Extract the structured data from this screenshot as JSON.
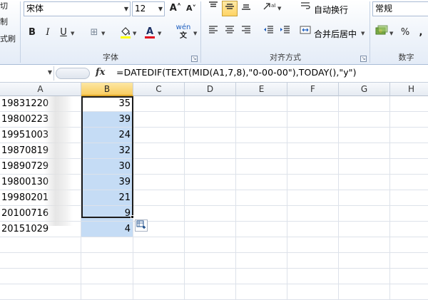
{
  "ribbon": {
    "clipboard": {
      "cut_label": "切",
      "copy_label": "制",
      "painter_label": "式刷"
    },
    "font": {
      "name": "宋体",
      "size": "12",
      "grow_icon": "A˄",
      "shrink_icon": "A˅",
      "bold": "B",
      "italic": "I",
      "underline": "U",
      "phonetic": "wén",
      "group_label": "字体"
    },
    "alignment": {
      "wrap_text": "自动换行",
      "merge_center": "合并后居中",
      "group_label": "对齐方式"
    },
    "number": {
      "format": "常规",
      "percent": "%",
      "comma": ",",
      "group_label": "数字"
    }
  },
  "formula_bar": {
    "fx_label": "fx",
    "formula": "=DATEDIF(TEXT(MID(A1,7,8),\"0-00-00\"),TODAY(),\"y\")"
  },
  "columns": [
    "A",
    "B",
    "C",
    "D",
    "E",
    "F",
    "G",
    "H"
  ],
  "rows": [
    {
      "a": "19831220",
      "b": "35"
    },
    {
      "a": "19800223",
      "b": "39"
    },
    {
      "a": "19951003",
      "b": "24"
    },
    {
      "a": "19870819",
      "b": "32"
    },
    {
      "a": "19890729",
      "b": "30"
    },
    {
      "a": "19800130",
      "b": "39"
    },
    {
      "a": "19980201",
      "b": "21"
    },
    {
      "a": "20100716",
      "b": "9"
    },
    {
      "a": "20151029",
      "b": "4"
    }
  ],
  "colors": {
    "selection_fill": "#c5dcf5",
    "selected_header": "#f9cd61",
    "grid_line": "#dde2ea"
  }
}
